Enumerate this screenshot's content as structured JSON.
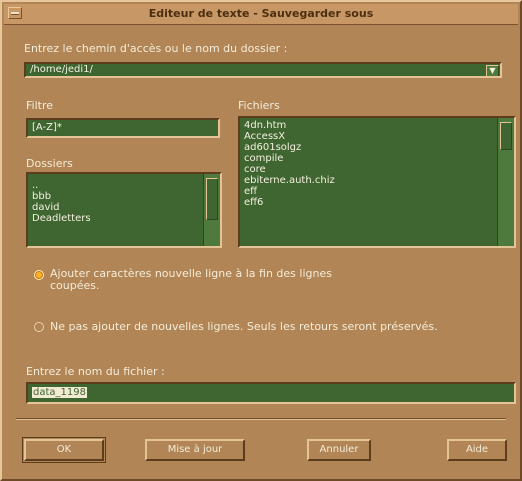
{
  "window": {
    "title": "Editeur de texte - Sauvegarder sous"
  },
  "path": {
    "label": "Entrez le chemin d'accès ou le nom du dossier :",
    "value": "/home/jedi1/"
  },
  "filter": {
    "label": "Filtre",
    "value": "[A-Z]*"
  },
  "folders": {
    "label": "Dossiers",
    "items": [
      "..",
      "bbb",
      "david",
      "Deadletters"
    ]
  },
  "files": {
    "label": "Fichiers",
    "items": [
      "4dn.htm",
      "AccessX",
      "ad601solgz",
      "compile",
      "core",
      "ebiterne.auth.chiz",
      "eff",
      "eff6"
    ]
  },
  "options": {
    "add_newlines": "Ajouter caractères nouvelle ligne à la fin des lignes coupées.",
    "no_newlines": "Ne pas ajouter de nouvelles lignes. Seuls les retours seront préservés.",
    "selected": "add_newlines"
  },
  "filename": {
    "label": "Entrez le nom du fichier :",
    "value": "data_1198"
  },
  "buttons": {
    "ok": "OK",
    "update": "Mise à jour",
    "cancel": "Annuler",
    "help": "Aide"
  },
  "colors": {
    "window_bg": "#b18556",
    "field_bg": "#3f6530",
    "radio_selected": "#ffb22a"
  }
}
